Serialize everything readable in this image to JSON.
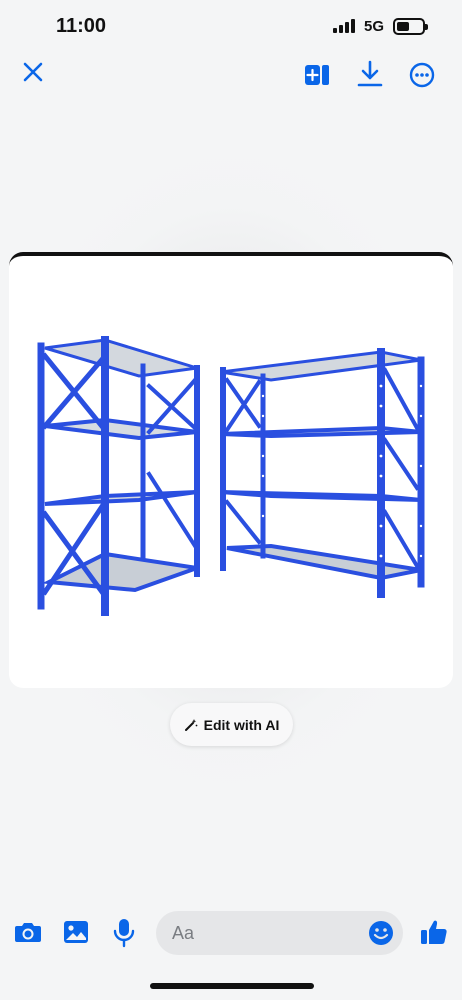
{
  "status_bar": {
    "time": "11:00",
    "network": "5G",
    "battery_level": 0.35,
    "signal_bars": 4
  },
  "toolbar": {
    "close_icon": "close-icon",
    "add_icon": "add-to-collection-icon",
    "download_icon": "download-icon",
    "more_icon": "more-options-icon"
  },
  "image": {
    "subject": "blue steel storage shelving racks",
    "accent_color": "#2a4fe0"
  },
  "edit_ai": {
    "label": "Edit with AI",
    "icon": "magic-wand-icon"
  },
  "composer": {
    "placeholder": "Aa",
    "camera_icon": "camera-icon",
    "gallery_icon": "gallery-icon",
    "mic_icon": "microphone-icon",
    "emoji_icon": "emoji-icon",
    "like_icon": "thumbs-up-icon"
  },
  "colors": {
    "brand_blue": "#0a66e8",
    "rack_blue": "#2a4fe0",
    "shelf_gray": "#c8ced6"
  }
}
